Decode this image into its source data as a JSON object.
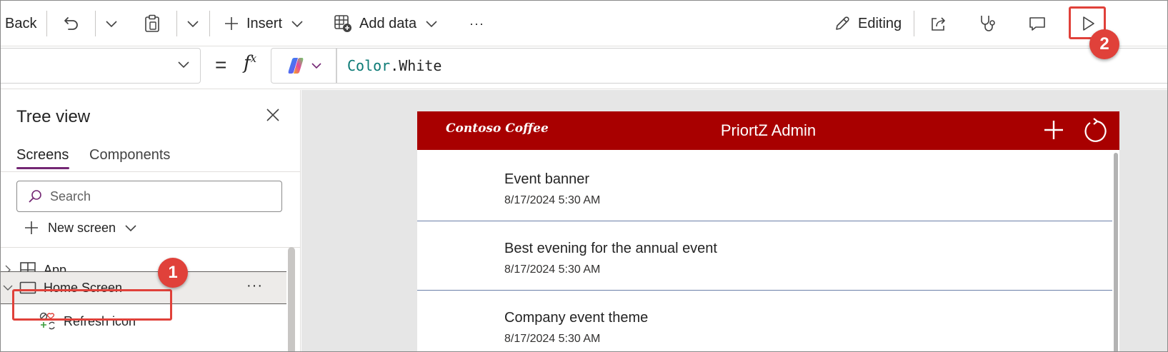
{
  "toolbar": {
    "back_label": "Back",
    "insert_label": "Insert",
    "add_data_label": "Add data",
    "more_label": "···",
    "editing_label": "Editing"
  },
  "formula_bar": {
    "equals": "=",
    "fx": "f",
    "fx_sup": "x",
    "formula_object": "Color",
    "formula_rest": ".White"
  },
  "tree_view": {
    "title": "Tree view",
    "tabs": [
      {
        "label": "Screens",
        "active": true
      },
      {
        "label": "Components",
        "active": false
      }
    ],
    "search_placeholder": "Search",
    "new_screen_label": "New screen",
    "nodes": [
      {
        "label": "App",
        "icon": "app-grid-icon"
      },
      {
        "label": "Home Screen",
        "icon": "screen-icon",
        "selected": true,
        "more": "···"
      },
      {
        "label": "Refresh icon",
        "icon": "refresh-control-icon"
      }
    ]
  },
  "app_preview": {
    "brand": "Contoso Coffee",
    "title": "PriortZ Admin",
    "header_color": "#a80000",
    "items": [
      {
        "title": "Event banner",
        "date": "8/17/2024 5:30 AM"
      },
      {
        "title": "Best evening for the annual event",
        "date": "8/17/2024 5:30 AM"
      },
      {
        "title": "Company event theme",
        "date": "8/17/2024 5:30 AM"
      }
    ]
  },
  "callouts": {
    "one": "1",
    "two": "2",
    "color": "#e0413a"
  },
  "colors": {
    "accent": "#742774"
  }
}
